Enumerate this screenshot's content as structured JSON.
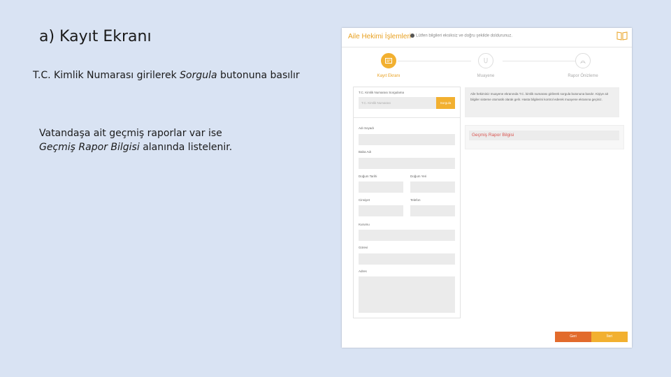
{
  "slide": {
    "title": "a) Kayıt Ekranı",
    "instruction_1_a": "T.C. Kimlik Numarası girilerek ",
    "instruction_1_b": "Sorgula",
    "instruction_1_c": " butonuna basılır",
    "instruction_2_a": "Vatandaşa ait geçmiş raporlar var ise",
    "instruction_2_b": "Geçmiş Rapor Bilgisi",
    "instruction_2_c": " alanında listelenir."
  },
  "app": {
    "title": "Aile Hekimi İşlemleri",
    "header_info": "Lütfen bilgileri eksiksiz ve doğru şekilde doldurunuz.",
    "steps": [
      {
        "label": "Kayıt Ekranı",
        "icon": "id-card-icon",
        "active": true
      },
      {
        "label": "Muayene",
        "icon": "stethoscope-icon",
        "active": false
      },
      {
        "label": "Rapor Önizleme",
        "icon": "pdf-icon",
        "active": false
      }
    ],
    "form": {
      "tc_label": "T.C. Kimlik Numarası Sorgulama",
      "tc_placeholder": "T.C. Kimlik Numarası",
      "sorgula": "Sorgula",
      "ad_soyadi": "Adı Soyadı",
      "baba_adi": "Baba Adı",
      "dogum_tarihi": "Doğum Tarihi",
      "dogum_yeri": "Doğum Yeri",
      "cinsiyet": "Cinsiyet",
      "telefon": "Telefon",
      "kurumu": "Kurumu",
      "gorevi": "Görevi",
      "adres": "Adres"
    },
    "hint": "Aile hekiminiz muayene ekranında T.C. kimlik numarası girilerek sorgula butonuna basılır. Kişiye ait bilgiler sisteme otomatik olarak gelir. Hasta bilgilerini kontrol ederek muayene ekranına geçiniz.",
    "history_title": "Geçmiş Rapor Bilgisi",
    "buttons": {
      "prev": "Geri",
      "next": "İleri"
    },
    "colors": {
      "accent": "#f2b030",
      "prev": "#e26b2c",
      "history_title": "#d9534f"
    }
  }
}
